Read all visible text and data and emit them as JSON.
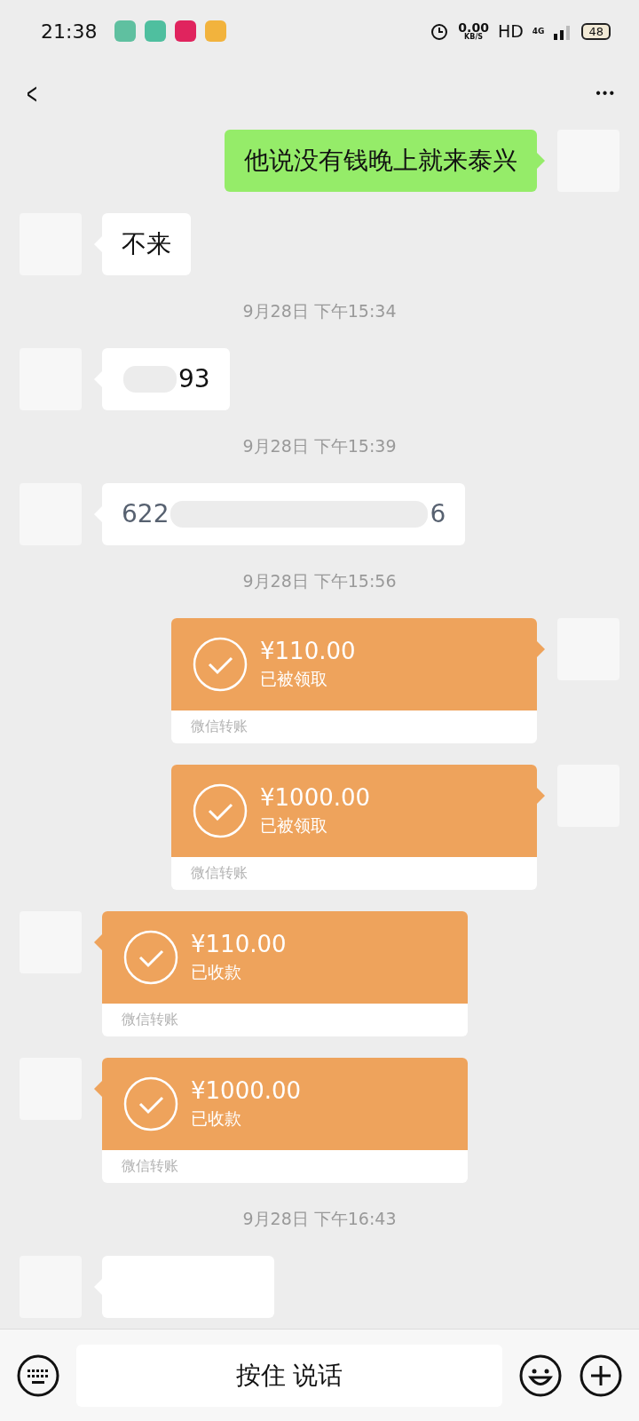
{
  "status_bar": {
    "time": "21:38",
    "notification_icons": [
      {
        "color": "#5fc0a0"
      },
      {
        "color": "#4fbf9f"
      },
      {
        "color": "#e0245e"
      },
      {
        "color": "#f2b33d"
      }
    ],
    "speed_value": "0.00",
    "speed_unit": "KB/S",
    "hd": "HD",
    "network": "4G",
    "battery": "48"
  },
  "header": {
    "back": "<",
    "more": "•••"
  },
  "messages": [
    {
      "kind": "text",
      "sent": true,
      "text": "他说没有钱晚上就来泰兴"
    },
    {
      "kind": "text",
      "sent": false,
      "text": "不来"
    },
    {
      "kind": "time",
      "text": "9月28日 下午15:34"
    },
    {
      "kind": "redacted",
      "sent": false,
      "after": "93"
    },
    {
      "kind": "time",
      "text": "9月28日 下午15:39"
    },
    {
      "kind": "redacted",
      "sent": false,
      "before": "622",
      "after": "6"
    },
    {
      "kind": "time",
      "text": "9月28日 下午15:56"
    },
    {
      "kind": "transfer",
      "sent": true,
      "amount": "¥110.00",
      "status": "已被领取",
      "footer": "微信转账"
    },
    {
      "kind": "transfer",
      "sent": true,
      "amount": "¥1000.00",
      "status": "已被领取",
      "footer": "微信转账"
    },
    {
      "kind": "transfer",
      "sent": false,
      "amount": "¥110.00",
      "status": "已收款",
      "footer": "微信转账"
    },
    {
      "kind": "transfer",
      "sent": false,
      "amount": "¥1000.00",
      "status": "已收款",
      "footer": "微信转账"
    },
    {
      "kind": "time",
      "text": "9月28日 下午16:43"
    },
    {
      "kind": "partial",
      "sent": false
    }
  ],
  "input_bar": {
    "hold_to_talk": "按住 说话"
  }
}
